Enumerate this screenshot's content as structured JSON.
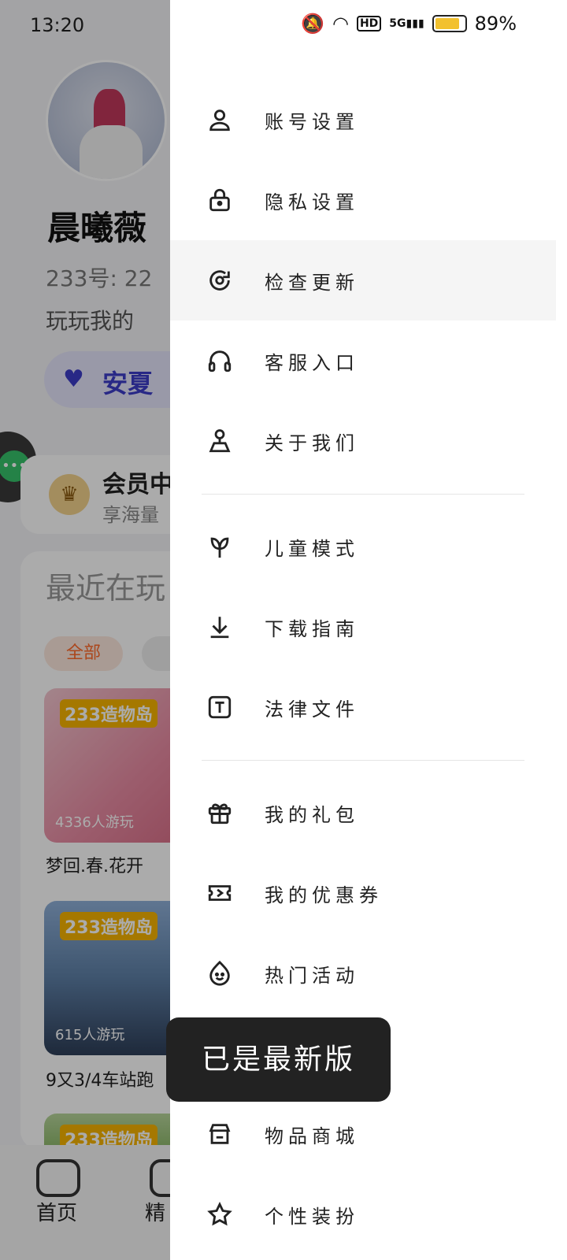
{
  "status_bar": {
    "time": "13:20",
    "battery": "89%",
    "battery_level": 0.89
  },
  "profile": {
    "name": "晨曦薇",
    "uid": "233号: 22",
    "bio": "玩玩我的",
    "tag": "安夏"
  },
  "vip": {
    "title": "会员中",
    "subtitle": "享海量"
  },
  "recent": {
    "title": "最近在玩",
    "filter_all": "全部",
    "games": [
      {
        "name": "梦回.春.花开",
        "plays": "4336人游玩",
        "logo": "233造物岛"
      },
      {
        "name": "9又3/4车站跑",
        "plays": "615人游玩",
        "logo": "233造物岛"
      },
      {
        "name": "",
        "plays": "",
        "logo": "233造物岛"
      }
    ]
  },
  "tabbar": {
    "home": "首页",
    "picks": "精"
  },
  "drawer": {
    "group1": [
      {
        "label": "账号设置",
        "icon": "user-icon"
      },
      {
        "label": "隐私设置",
        "icon": "lock-icon"
      },
      {
        "label": "检查更新",
        "icon": "refresh-icon"
      },
      {
        "label": "客服入口",
        "icon": "headset-icon"
      },
      {
        "label": "关于我们",
        "icon": "about-icon"
      }
    ],
    "group2": [
      {
        "label": "儿童模式",
        "icon": "sprout-icon"
      },
      {
        "label": "下载指南",
        "icon": "download-icon"
      },
      {
        "label": "法律文件",
        "icon": "text-document-icon"
      }
    ],
    "group3": [
      {
        "label": "我的礼包",
        "icon": "gift-icon"
      },
      {
        "label": "我的优惠券",
        "icon": "ticket-icon"
      },
      {
        "label": "热门活动",
        "icon": "flame-face-icon"
      },
      {
        "label": "物品商城",
        "icon": "store-icon"
      },
      {
        "label": "个性装扮",
        "icon": "star-icon"
      }
    ]
  },
  "toast": {
    "text": "已是最新版"
  },
  "colors": {
    "accent": "#ff6a2a",
    "tag": "#3c3cc8",
    "battery": "#f2c12e"
  }
}
